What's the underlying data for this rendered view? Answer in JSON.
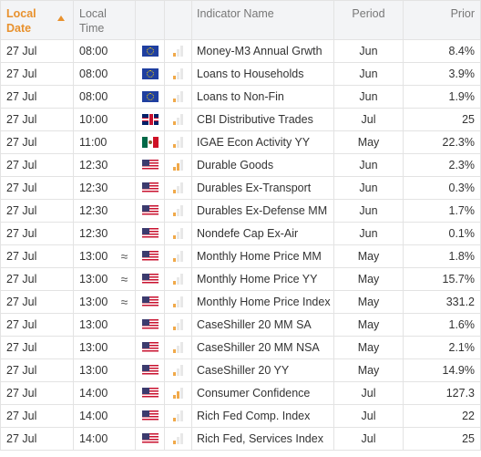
{
  "header": {
    "local_date": "Local Date",
    "local_time": "Local Time",
    "indicator_name": "Indicator Name",
    "period": "Period",
    "prior": "Prior"
  },
  "colors": {
    "accent": "#e8912d",
    "importance": "#f0a94a",
    "header_bg": "#f3f4f6",
    "border": "#e3e3e3"
  },
  "rows": [
    {
      "date": "27 Jul",
      "time": "08:00",
      "approx": "",
      "flag": "eu",
      "importance": 1,
      "name": "Money-M3 Annual Grwth",
      "period": "Jun",
      "prior": "8.4%"
    },
    {
      "date": "27 Jul",
      "time": "08:00",
      "approx": "",
      "flag": "eu",
      "importance": 1,
      "name": "Loans to Households",
      "period": "Jun",
      "prior": "3.9%"
    },
    {
      "date": "27 Jul",
      "time": "08:00",
      "approx": "",
      "flag": "eu",
      "importance": 1,
      "name": "Loans to Non-Fin",
      "period": "Jun",
      "prior": "1.9%"
    },
    {
      "date": "27 Jul",
      "time": "10:00",
      "approx": "",
      "flag": "gb",
      "importance": 1,
      "name": "CBI Distributive Trades",
      "period": "Jul",
      "prior": "25"
    },
    {
      "date": "27 Jul",
      "time": "11:00",
      "approx": "",
      "flag": "mx",
      "importance": 1,
      "name": "IGAE Econ Activity YY",
      "period": "May",
      "prior": "22.3%"
    },
    {
      "date": "27 Jul",
      "time": "12:30",
      "approx": "",
      "flag": "us",
      "importance": 2,
      "name": "Durable Goods",
      "period": "Jun",
      "prior": "2.3%"
    },
    {
      "date": "27 Jul",
      "time": "12:30",
      "approx": "",
      "flag": "us",
      "importance": 1,
      "name": "Durables Ex-Transport",
      "period": "Jun",
      "prior": "0.3%"
    },
    {
      "date": "27 Jul",
      "time": "12:30",
      "approx": "",
      "flag": "us",
      "importance": 1,
      "name": "Durables Ex-Defense MM",
      "period": "Jun",
      "prior": "1.7%"
    },
    {
      "date": "27 Jul",
      "time": "12:30",
      "approx": "",
      "flag": "us",
      "importance": 1,
      "name": "Nondefe Cap Ex-Air",
      "period": "Jun",
      "prior": "0.1%"
    },
    {
      "date": "27 Jul",
      "time": "13:00",
      "approx": "≈",
      "flag": "us",
      "importance": 1,
      "name": "Monthly Home Price MM",
      "period": "May",
      "prior": "1.8%"
    },
    {
      "date": "27 Jul",
      "time": "13:00",
      "approx": "≈",
      "flag": "us",
      "importance": 1,
      "name": "Monthly Home Price YY",
      "period": "May",
      "prior": "15.7%"
    },
    {
      "date": "27 Jul",
      "time": "13:00",
      "approx": "≈",
      "flag": "us",
      "importance": 1,
      "name": "Monthly Home Price Index",
      "period": "May",
      "prior": "331.2"
    },
    {
      "date": "27 Jul",
      "time": "13:00",
      "approx": "",
      "flag": "us",
      "importance": 1,
      "name": "CaseShiller 20 MM SA",
      "period": "May",
      "prior": "1.6%"
    },
    {
      "date": "27 Jul",
      "time": "13:00",
      "approx": "",
      "flag": "us",
      "importance": 1,
      "name": "CaseShiller 20 MM NSA",
      "period": "May",
      "prior": "2.1%"
    },
    {
      "date": "27 Jul",
      "time": "13:00",
      "approx": "",
      "flag": "us",
      "importance": 1,
      "name": "CaseShiller 20 YY",
      "period": "May",
      "prior": "14.9%"
    },
    {
      "date": "27 Jul",
      "time": "14:00",
      "approx": "",
      "flag": "us",
      "importance": 2,
      "name": "Consumer Confidence",
      "period": "Jul",
      "prior": "127.3"
    },
    {
      "date": "27 Jul",
      "time": "14:00",
      "approx": "",
      "flag": "us",
      "importance": 1,
      "name": "Rich Fed Comp. Index",
      "period": "Jul",
      "prior": "22"
    },
    {
      "date": "27 Jul",
      "time": "14:00",
      "approx": "",
      "flag": "us",
      "importance": 1,
      "name": "Rich Fed, Services Index",
      "period": "Jul",
      "prior": "25"
    }
  ]
}
